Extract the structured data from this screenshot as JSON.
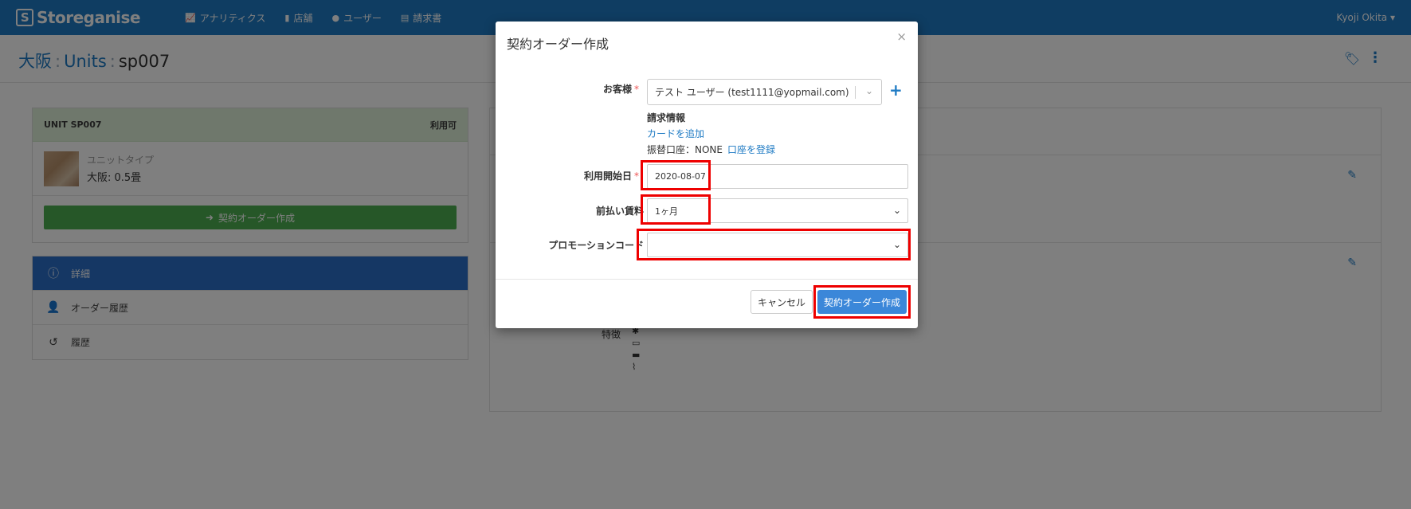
{
  "nav": {
    "brand": "Storeganise",
    "items": [
      {
        "icon": "chart-line-icon",
        "label": "アナリティクス"
      },
      {
        "icon": "building-icon",
        "label": "店舗"
      },
      {
        "icon": "user-icon",
        "label": "ユーザー"
      },
      {
        "icon": "file-icon",
        "label": "請求書"
      }
    ],
    "user": "Kyoji Okita"
  },
  "breadcrumb": {
    "site": "大阪",
    "section": "Units",
    "current": "sp007"
  },
  "unit": {
    "title": "UNIT SP007",
    "status": "利用可",
    "type_label": "ユニットタイプ",
    "type_value": "大阪: 0.5畳",
    "create_button": "契約オーダー作成"
  },
  "side_menu": [
    {
      "icon": "info-icon",
      "label": "詳細",
      "active": true
    },
    {
      "icon": "user-clock-icon",
      "label": "オーダー履歴",
      "active": false
    },
    {
      "icon": "history-icon",
      "label": "履歴",
      "active": false
    }
  ],
  "detail": {
    "features_label": "特徴"
  },
  "modal": {
    "title": "契約オーダー作成",
    "close": "×",
    "customer_label": "お客様",
    "customer_value": "テスト ユーザー (test1111@yopmail.com)",
    "billing_title": "請求情報",
    "add_card": "カードを追加",
    "account_label": "振替口座：NONE",
    "register_account": "口座を登録",
    "start_date_label": "利用開始日",
    "start_date_value": "2020-08-07",
    "prepay_label": "前払い賃料",
    "prepay_value": "1ヶ月",
    "promo_label": "プロモーションコード",
    "promo_value": "",
    "cancel": "キャンセル",
    "submit": "契約オーダー作成"
  },
  "colors": {
    "brand": "#1f7bc4",
    "success": "#4caf50",
    "highlight": "#e00000",
    "primary_button": "#3b87d9"
  }
}
